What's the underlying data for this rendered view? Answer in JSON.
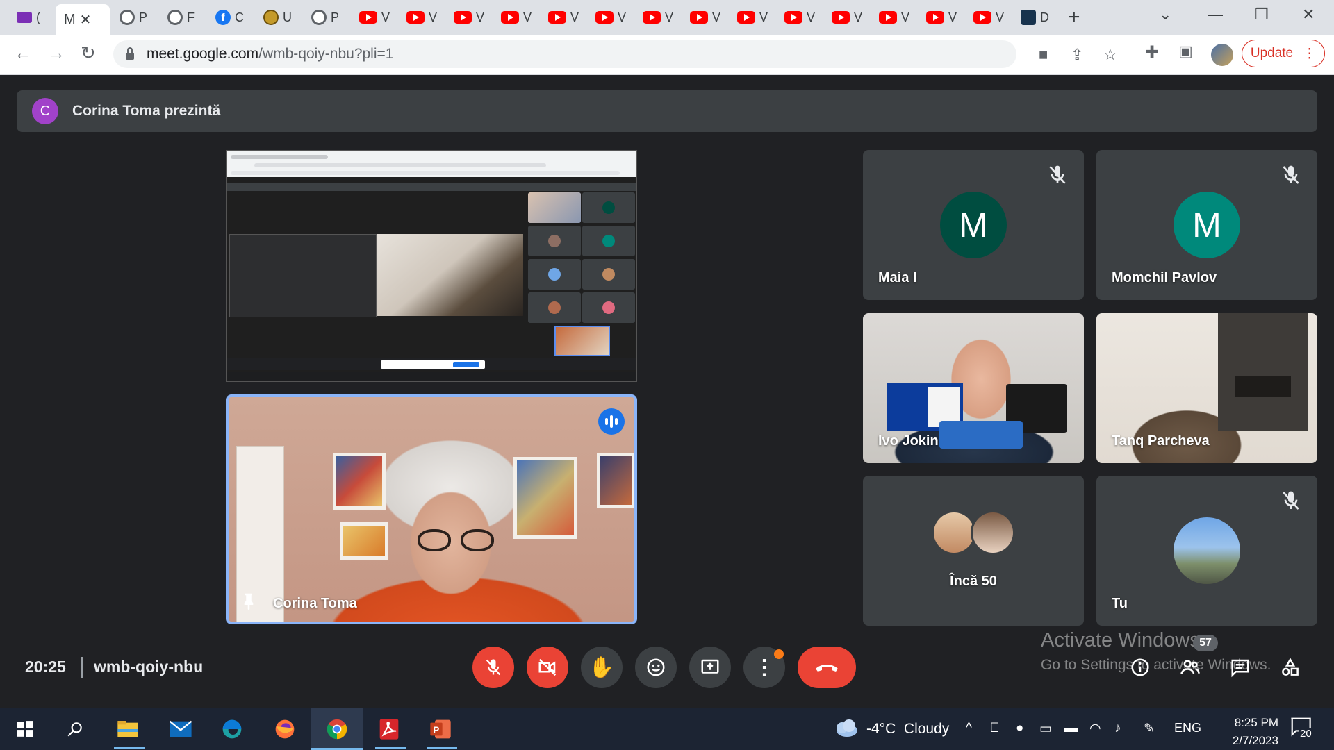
{
  "browser": {
    "tabs": [
      {
        "icon": "mail-icon",
        "label": "("
      },
      {
        "icon": "meet-icon",
        "label": "M",
        "active": true
      },
      {
        "icon": "globe-icon",
        "label": "P"
      },
      {
        "icon": "globe-icon",
        "label": "F"
      },
      {
        "icon": "facebook-icon",
        "label": "C"
      },
      {
        "icon": "seal-icon",
        "label": "U"
      },
      {
        "icon": "globe-icon",
        "label": "P"
      },
      {
        "icon": "youtube-icon",
        "label": "V"
      },
      {
        "icon": "youtube-icon",
        "label": "V"
      },
      {
        "icon": "youtube-icon",
        "label": "V"
      },
      {
        "icon": "youtube-icon",
        "label": "V"
      },
      {
        "icon": "youtube-icon",
        "label": "V"
      },
      {
        "icon": "youtube-icon",
        "label": "V"
      },
      {
        "icon": "youtube-icon",
        "label": "V"
      },
      {
        "icon": "youtube-icon",
        "label": "V"
      },
      {
        "icon": "youtube-icon",
        "label": "V"
      },
      {
        "icon": "youtube-icon",
        "label": "V"
      },
      {
        "icon": "youtube-icon",
        "label": "V"
      },
      {
        "icon": "youtube-icon",
        "label": "V"
      },
      {
        "icon": "youtube-icon",
        "label": "V"
      },
      {
        "icon": "youtube-icon",
        "label": "V"
      },
      {
        "icon": "hex-icon",
        "label": "D"
      }
    ],
    "url_host": "meet.google.com",
    "url_path": "/wmb-qoiy-nbu?pli=1",
    "update_label": "Update"
  },
  "meeting": {
    "presenter_initial": "C",
    "presenter_banner": "Corina Toma prezintă",
    "main_speaker": "Corina Toma",
    "time": "20:25",
    "code": "wmb-qoiy-nbu",
    "participants_count": "57",
    "tiles": [
      {
        "name": "Maia I",
        "initial": "M",
        "avatar_color": "#004d40",
        "muted": true
      },
      {
        "name": "Momchil Pavlov",
        "initial": "M",
        "avatar_color": "#00897b",
        "muted": true
      },
      {
        "name": "Ivo Jokin",
        "muted": false
      },
      {
        "name": "Tanq Parcheva",
        "muted": false
      },
      {
        "name": "Încă 50"
      },
      {
        "name": "Tu",
        "muted": true
      }
    ]
  },
  "watermark": {
    "line1": "Activate Windows",
    "line2": "Go to Settings to activate Windows."
  },
  "taskbar": {
    "temperature": "-4°C",
    "condition": "Cloudy",
    "language": "ENG",
    "time": "8:25 PM",
    "date": "2/7/2023",
    "notifications": "20"
  },
  "colors": {
    "meet_bg": "#202124",
    "tile_bg": "#3c4043",
    "danger": "#ea4335",
    "accent": "#1a73e8"
  }
}
